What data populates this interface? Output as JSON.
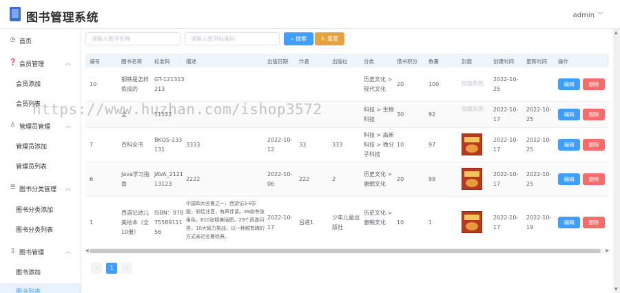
{
  "app": {
    "title": "图书管理系统",
    "user": "admin",
    "user_chevron": "chevron-down-icon"
  },
  "sidebar": {
    "home": {
      "label": "首页",
      "icon": "home-icon"
    },
    "groups": [
      {
        "label": "会员管理",
        "icon": "question-circle-icon",
        "items": [
          "会员添加",
          "会员列表"
        ]
      },
      {
        "label": "管理员管理",
        "icon": "user-icon",
        "items": [
          "管理员添加",
          "管理员列表"
        ]
      },
      {
        "label": "图书分类管理",
        "icon": "sliders-icon",
        "items": [
          "图书分类添加",
          "图书分类列表"
        ]
      },
      {
        "label": "图书管理",
        "icon": "book-icon",
        "items": [
          "图书添加",
          "图书列表"
        ]
      }
    ]
  },
  "search": {
    "name_placeholder": "请输入图书名称",
    "code_placeholder": "请输入图书标准码",
    "search_label": "搜索",
    "reset_label": "重置"
  },
  "table": {
    "headers": [
      "编号",
      "图书名称",
      "标准码",
      "描述",
      "出版日期",
      "作者",
      "出版社",
      "分类",
      "借书积分",
      "数量",
      "封面",
      "创建时间",
      "更新时间",
      "操作"
    ],
    "rows": [
      {
        "id": "10",
        "name": "钢铁是怎样炼成的",
        "code": "GT-121313213",
        "desc": "",
        "pub_date": "",
        "author": "",
        "publisher": "",
        "category": "历史文化 > 现代文化",
        "points": "20",
        "qty": "100",
        "cover": "加载失败",
        "created": "2022-10-25",
        "updated": ""
      },
      {
        "id": "",
        "name": "全",
        "code": "11122",
        "desc": "",
        "pub_date": "",
        "author": "",
        "publisher": "",
        "category": "科技 > 生物科技",
        "points": "30",
        "qty": "92",
        "cover": "加载失败",
        "created": "2022-10-17",
        "updated": "2022-10-25"
      },
      {
        "id": "7",
        "name": "百科全书",
        "code": "BKQS-233131",
        "desc": "3333",
        "pub_date": "2022-10-12",
        "author": "33",
        "publisher": "333",
        "category": "科技 > 高新科技 > 微分子科技",
        "points": "10",
        "qty": "97",
        "cover": "",
        "created": "2022-10-17",
        "updated": "2022-10-25"
      },
      {
        "id": "6",
        "name": "Java学习指南",
        "code": "JAVA_212113123",
        "desc": "2222",
        "pub_date": "2022-10-06",
        "author": "222",
        "publisher": "2",
        "category": "历史文化 > 唐朝文化",
        "points": "20",
        "qty": "99",
        "cover": "",
        "created": "2022-10-17",
        "updated": "2022-10-25"
      },
      {
        "id": "1",
        "name": "西游记幼儿美绘本（全10册）",
        "code": "ISBN：9787558911156",
        "desc": "中国四大名著之一，西游记3-8岁版，彩绘注音，有声伴读。49款夸张角色，610张精美插图，29个西游问答，10大智力挑战，以一种越有趣的方式亲近名著经典。",
        "pub_date": "2022-10-17",
        "author": "吕进1",
        "publisher": "少年儿童出版社",
        "category": "历史文化 > 唐朝文化",
        "points": "10",
        "qty": "1",
        "cover": "",
        "created": "2022-10-17",
        "updated": "2022-10-19"
      }
    ],
    "edit_label": "编辑",
    "delete_label": "删除"
  },
  "pagination": {
    "current": "1",
    "prev": "‹",
    "next": "›"
  },
  "watermark": "https://www.huzhan.com/ishop3572"
}
